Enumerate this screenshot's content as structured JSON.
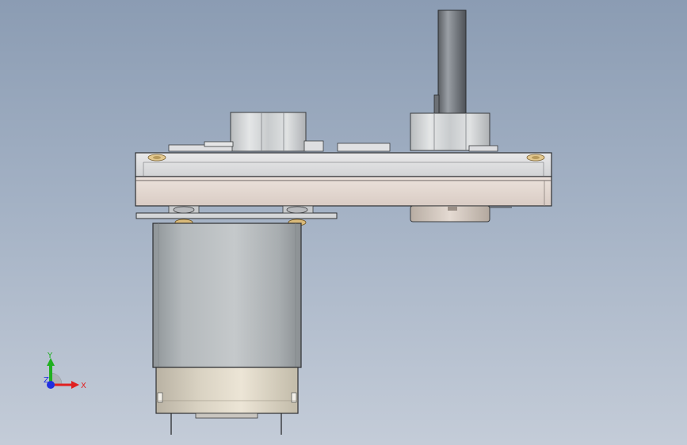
{
  "viewport": {
    "background_top": "#8b9cb3",
    "background_bottom": "#c4ccd8"
  },
  "triad": {
    "x_label": "X",
    "y_label": "Y",
    "z_label": "Z",
    "x_color": "#e02020",
    "y_color": "#20b020",
    "z_color": "#2030e0"
  }
}
